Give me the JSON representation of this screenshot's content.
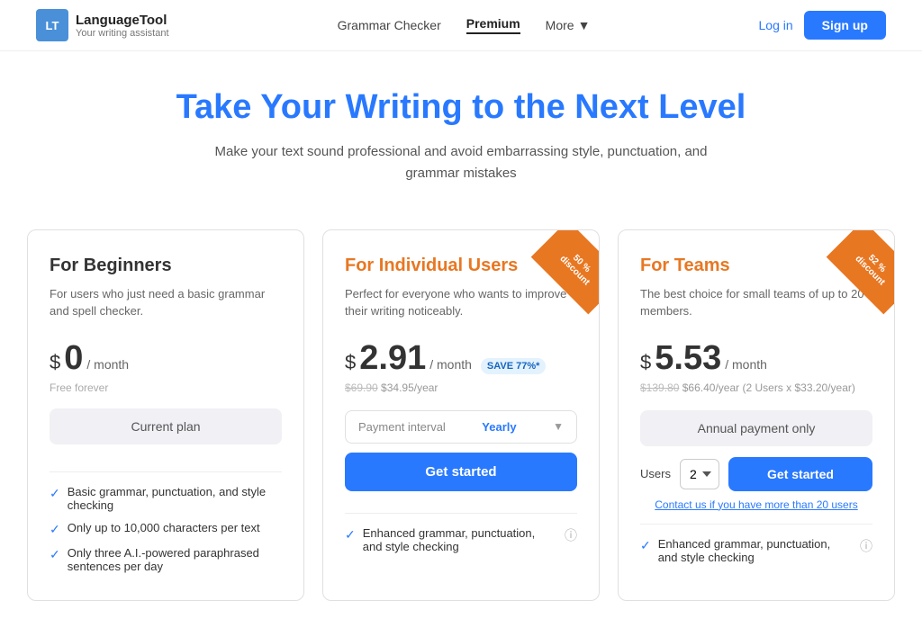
{
  "header": {
    "logo_initials": "LT",
    "logo_name": "LanguageTool",
    "logo_sub": "Your writing assistant",
    "nav": [
      {
        "label": "Grammar Checker",
        "active": false
      },
      {
        "label": "Premium",
        "active": true
      },
      {
        "label": "More",
        "active": false
      }
    ],
    "login_label": "Log in",
    "signup_label": "Sign up"
  },
  "hero": {
    "title": "Take Your Writing to the Next Level",
    "subtitle": "Make your text sound professional and avoid embarrassing style, punctuation, and grammar mistakes"
  },
  "pricing": {
    "cards": [
      {
        "id": "beginners",
        "title": "For Beginners",
        "title_color": "default",
        "desc": "For users who just need a basic grammar and spell checker.",
        "price_dollar": "$",
        "price_amount": "0",
        "price_per": "/ month",
        "price_sub": "Free forever",
        "ribbon": null,
        "cta_type": "current",
        "cta_label": "Current plan",
        "features": [
          {
            "text": "Basic grammar, punctuation, and style checking",
            "has_info": false
          },
          {
            "text": "Only up to 10,000 characters per text",
            "has_info": false
          },
          {
            "text": "Only three A.I.-powered paraphrased sentences per day",
            "has_info": false
          }
        ]
      },
      {
        "id": "individual",
        "title": "For Individual Users",
        "title_color": "orange",
        "desc": "Perfect for everyone who wants to improve their writing noticeably.",
        "price_dollar": "$",
        "price_amount": "2.91",
        "price_per": "/ month",
        "price_badge": "SAVE 77%*",
        "price_old": "$69.90",
        "price_new": "$34.95/year",
        "ribbon_text": "50 % discount",
        "cta_type": "get_started",
        "cta_label": "Get started",
        "payment_interval_label": "Payment interval",
        "payment_interval_value": "Yearly",
        "features": [
          {
            "text": "Enhanced grammar, punctuation, and style checking",
            "has_info": true
          }
        ]
      },
      {
        "id": "teams",
        "title": "For Teams",
        "title_color": "orange",
        "desc": "The best choice for small teams of up to 20 members.",
        "price_dollar": "$",
        "price_amount": "5.53",
        "price_per": "/ month",
        "price_old": "$139.80",
        "price_new": "$66.40/year",
        "price_detail": "(2 Users x $33.20/year)",
        "ribbon_text": "52 % discount",
        "annual_only_label": "Annual payment only",
        "users_label": "Users",
        "users_value": "2",
        "cta_label": "Get started",
        "contact_label": "Contact us if you have more than 20 users",
        "features": [
          {
            "text": "Enhanced grammar, punctuation, and style checking",
            "has_info": true
          }
        ]
      }
    ]
  }
}
